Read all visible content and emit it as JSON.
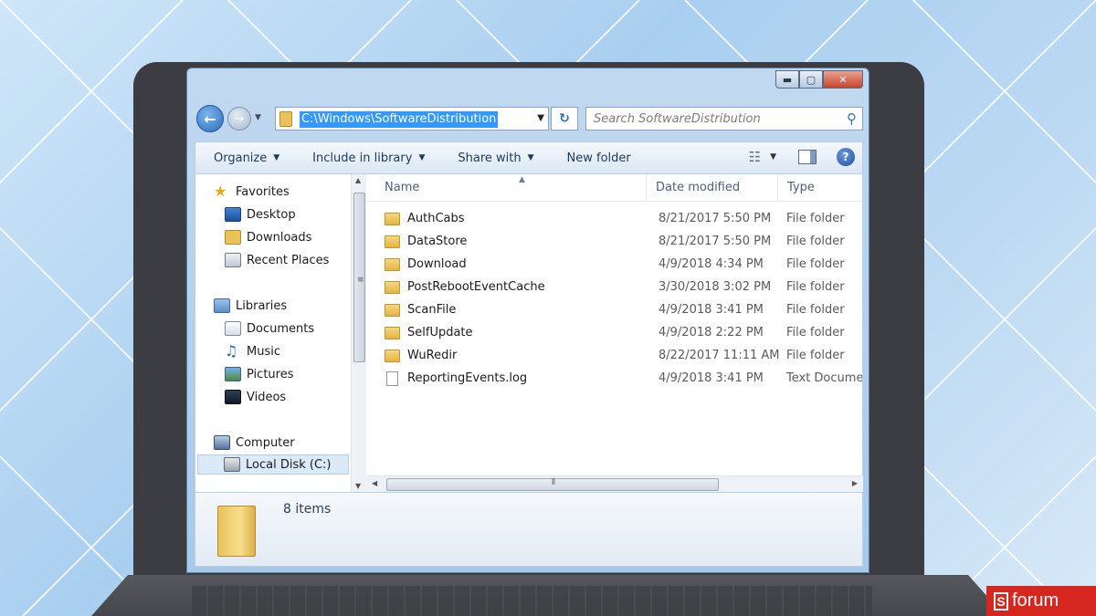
{
  "window": {
    "caption": {
      "minimize": "▬",
      "maximize": "▢",
      "close": "✕"
    }
  },
  "address_bar": {
    "path": "C:\\Windows\\SoftwareDistribution",
    "search_placeholder": "Search SoftwareDistribution"
  },
  "command_bar": {
    "organize": "Organize",
    "include_in_library": "Include in library",
    "share_with": "Share with",
    "new_folder": "New folder"
  },
  "nav_pane": {
    "favorites": "Favorites",
    "desktop": "Desktop",
    "downloads": "Downloads",
    "recent_places": "Recent Places",
    "libraries": "Libraries",
    "documents": "Documents",
    "music": "Music",
    "pictures": "Pictures",
    "videos": "Videos",
    "computer": "Computer",
    "local_disk": "Local Disk (C:)"
  },
  "columns": {
    "name": "Name",
    "date_modified": "Date modified",
    "type": "Type"
  },
  "files": [
    {
      "name": "AuthCabs",
      "date": "8/21/2017 5:50 PM",
      "type": "File folder",
      "icon": "folder-icon"
    },
    {
      "name": "DataStore",
      "date": "8/21/2017 5:50 PM",
      "type": "File folder",
      "icon": "folder-icon"
    },
    {
      "name": "Download",
      "date": "4/9/2018 4:34 PM",
      "type": "File folder",
      "icon": "folder-icon"
    },
    {
      "name": "PostRebootEventCache",
      "date": "3/30/2018 3:02 PM",
      "type": "File folder",
      "icon": "folder-icon"
    },
    {
      "name": "ScanFile",
      "date": "4/9/2018 3:41 PM",
      "type": "File folder",
      "icon": "folder-icon"
    },
    {
      "name": "SelfUpdate",
      "date": "4/9/2018 2:22 PM",
      "type": "File folder",
      "icon": "folder-icon"
    },
    {
      "name": "WuRedir",
      "date": "8/22/2017 11:11 AM",
      "type": "File folder",
      "icon": "folder-icon"
    },
    {
      "name": "ReportingEvents.log",
      "date": "4/9/2018 3:41 PM",
      "type": "Text Documen",
      "icon": "text-file-icon"
    }
  ],
  "details": {
    "items_count": "8 items"
  },
  "brand": {
    "letter": "S",
    "text": "forum"
  },
  "colors": {
    "accent": "#3399ff",
    "brand": "#d5271f"
  }
}
